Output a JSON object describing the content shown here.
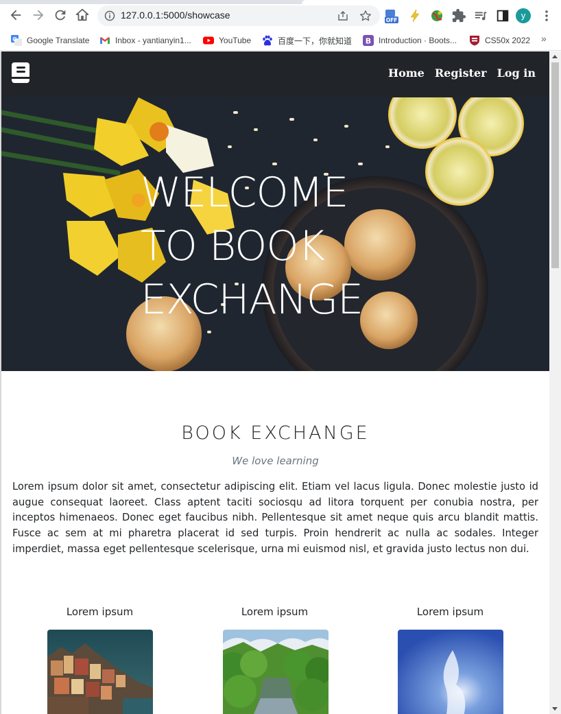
{
  "browser": {
    "url": "127.0.0.1:5000/showcase",
    "profile_initial": "y",
    "extension_badge": "OFF",
    "icons": [
      "back-icon",
      "forward-icon",
      "reload-icon",
      "home-icon",
      "info-icon",
      "share-icon",
      "star-icon",
      "extensions-icon",
      "media-icon",
      "side-panel-icon",
      "more-icon"
    ],
    "bookmarks": [
      {
        "label": "Google Translate",
        "icon": "google-translate-icon"
      },
      {
        "label": "Inbox - yantianyin1...",
        "icon": "gmail-icon"
      },
      {
        "label": "YouTube",
        "icon": "youtube-icon"
      },
      {
        "label": "百度一下，你就知道",
        "icon": "baidu-icon"
      },
      {
        "label": "Introduction · Boots...",
        "icon": "bootstrap-icon"
      },
      {
        "label": "CS50x 2022",
        "icon": "harvard-icon"
      }
    ],
    "more_bookmarks": "»"
  },
  "site": {
    "nav": {
      "logo": "book-icon",
      "links": [
        "Home",
        "Register",
        "Log in"
      ],
      "background": "#212529"
    },
    "hero": {
      "title_lines": [
        "WELCOME",
        "TO BOOK",
        "EXCHANGE"
      ]
    },
    "section": {
      "title": "BOOK EXCHANGE",
      "subtitle": "We love learning",
      "paragraph": "Lorem ipsum dolor sit amet, consectetur adipiscing elit. Etiam vel lacus ligula. Donec molestie justo id augue consequat laoreet. Class aptent taciti sociosqu ad litora torquent per conubia nostra, per inceptos himenaeos. Donec eget faucibus nibh. Pellentesque sit amet neque quis arcu blandit mattis. Fusce ac sem at mi pharetra placerat id sed turpis. Proin hendrerit ac nulla ac sodales. Integer imperdiet, massa eget pellentesque scelerisque, urna mi euismod nisl, et gravida justo lectus non dui."
    },
    "cards": [
      {
        "title": "Lorem ipsum"
      },
      {
        "title": "Lorem ipsum"
      },
      {
        "title": "Lorem ipsum"
      }
    ]
  }
}
